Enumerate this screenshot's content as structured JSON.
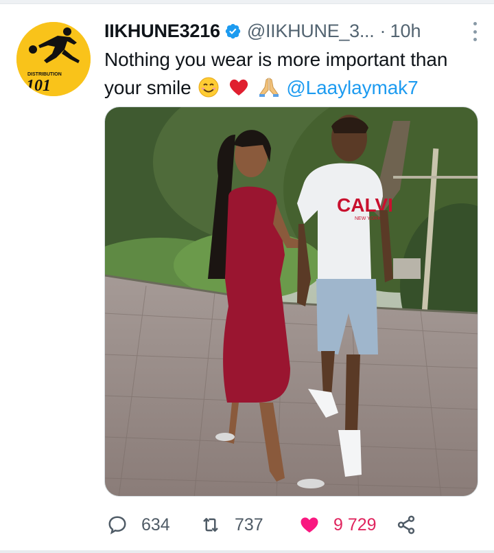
{
  "tweet": {
    "author": {
      "display_name": "IIKHUNE3216",
      "handle": "@IIKHUNE_3...",
      "verified": true,
      "avatar": {
        "text_top": "DISTRIBUTION",
        "text_bottom": "101",
        "bg_color": "#f9c31a"
      }
    },
    "separator": "·",
    "time": "10h",
    "text": "Nothing you wear is more important than your smile",
    "emojis": [
      "smiling-face-icon",
      "red-heart-icon",
      "folded-hands-icon"
    ],
    "mention": "@Laaylaymak7",
    "media": {
      "shirt_text": "CALVI",
      "shirt_subtext": "NEW YORK"
    },
    "stats": {
      "replies": "634",
      "retweets": "737",
      "likes": "9 729"
    },
    "liked": true
  },
  "colors": {
    "accent": "#1d9bf0",
    "like": "#e0245e",
    "muted": "#536471",
    "verified": "#1d9bf0"
  }
}
